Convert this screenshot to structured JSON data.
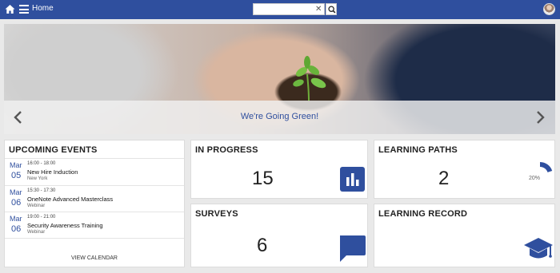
{
  "topbar": {
    "home_label": "Home",
    "search_placeholder": "",
    "search_clear": "✕"
  },
  "hero": {
    "caption": "We're Going Green!"
  },
  "events": {
    "title": "UPCOMING EVENTS",
    "items": [
      {
        "month": "Mar",
        "day": "05",
        "time": "16:00 - 18:00",
        "title": "New Hire Induction",
        "location": "New York"
      },
      {
        "month": "Mar",
        "day": "06",
        "time": "15:30 - 17:30",
        "title": "OneNote Advanced Masterclass",
        "location": "Webinar"
      },
      {
        "month": "Mar",
        "day": "06",
        "time": "19:00 - 21:00",
        "title": "Security Awareness Training",
        "location": "Webinar"
      }
    ],
    "view_calendar": "VIEW CALENDAR"
  },
  "in_progress": {
    "title": "IN PROGRESS",
    "count": "15"
  },
  "surveys": {
    "title": "SURVEYS",
    "count": "6"
  },
  "learning_paths": {
    "title": "LEARNING PATHS",
    "count": "2",
    "percent_label": "20%",
    "percent": 20
  },
  "learning_record": {
    "title": "LEARNING RECORD"
  },
  "icons": {
    "home": "home-icon",
    "menu": "hamburger-menu-icon",
    "search": "search-icon",
    "clear": "close-icon",
    "prev": "chevron-left-icon",
    "next": "chevron-right-icon",
    "in_progress": "bar-chart-icon",
    "surveys": "speech-bubble-icon",
    "learning_record": "graduation-cap-icon"
  },
  "colors": {
    "brand": "#2f4f9e",
    "page_bg": "#e9e9e9",
    "card_bg": "#ffffff"
  }
}
